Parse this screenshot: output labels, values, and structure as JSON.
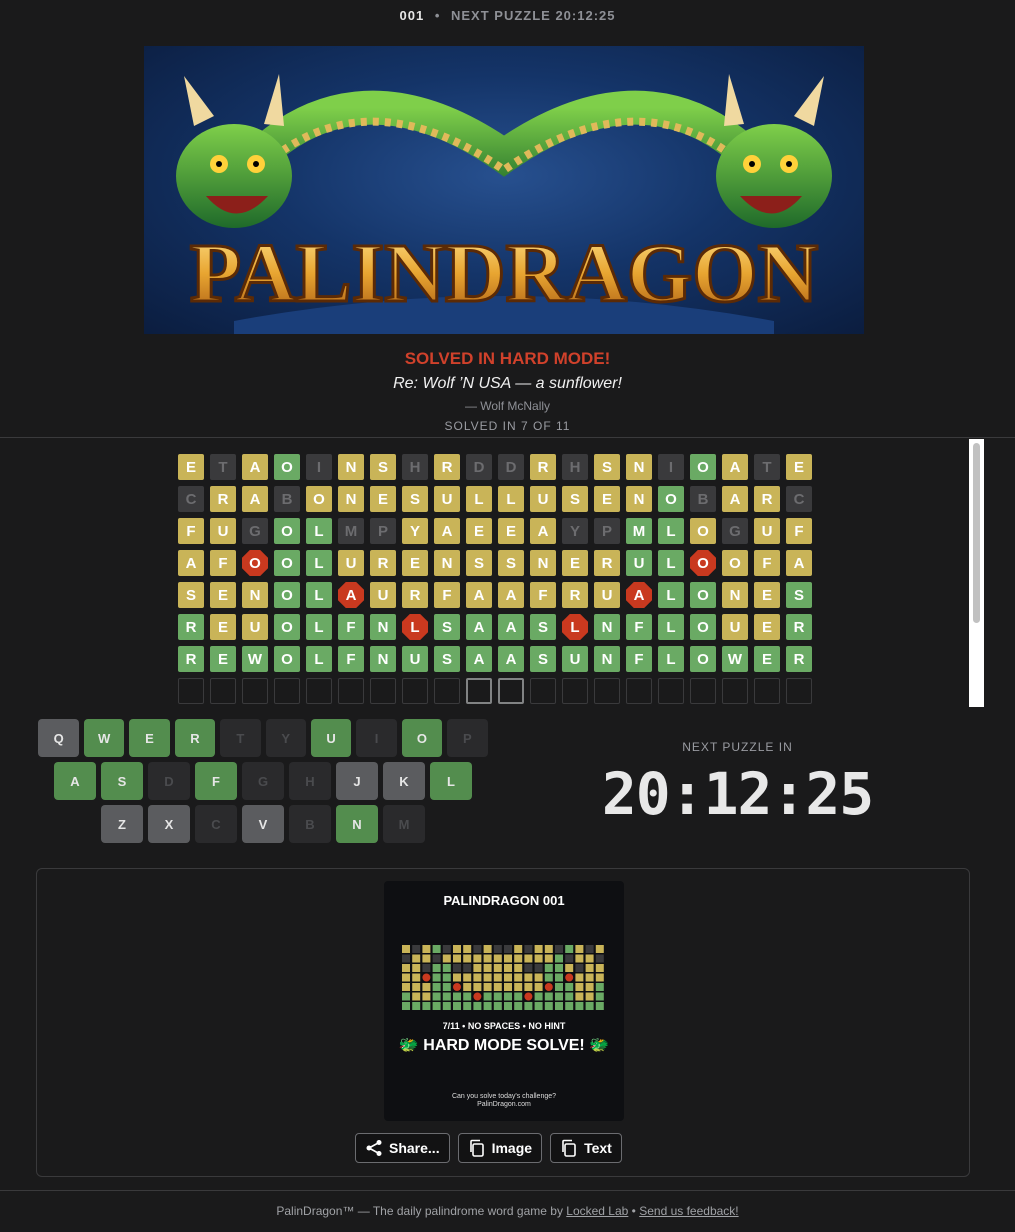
{
  "header": {
    "puzzle_number": "001",
    "separator": "•",
    "next_label": "NEXT PUZZLE 20:12:25"
  },
  "banner": {
    "logo_text": "PALINDRAGON",
    "icon": "dragon-icon"
  },
  "status": {
    "title": "SOLVED IN HARD MODE!",
    "phrase": "Re: Wolf ’N USA — a sunflower!",
    "author": "— Wolf McNally",
    "count": "SOLVED IN 7 OF 11"
  },
  "grid": {
    "rows": [
      {
        "letters": "ETAOINSHRDDRHSNIOATE",
        "states": "ydygdyydyddydyydgydy"
      },
      {
        "letters": "CRABONESULLUSENOBARC",
        "states": "dyydyyyyyyyyyyygdyyd"
      },
      {
        "letters": "FUGOLMPYAEEAYPMLOGUF",
        "states": "yydggddyyyyyddggydyy"
      },
      {
        "letters": "AFOOLURENSSNERULOOFA",
        "states": "yyrggyyyyyyyyyggryyy"
      },
      {
        "letters": "SENOLAURFAAFRUALONES",
        "states": "yyyggryyyyyyyyrggyyg"
      },
      {
        "letters": "REUOLFNLSAASLNFLOUER",
        "states": "gyyggggrggggrggggyyg"
      },
      {
        "letters": "REWOLFNUSAASUNFLOWER",
        "states": "gggggggggggggggggggg"
      }
    ],
    "empty_count": 20
  },
  "keyboard": {
    "rows": [
      [
        {
          "k": "Q",
          "s": "n"
        },
        {
          "k": "W",
          "s": "g"
        },
        {
          "k": "E",
          "s": "g"
        },
        {
          "k": "R",
          "s": "g"
        },
        {
          "k": "T",
          "s": "d"
        },
        {
          "k": "Y",
          "s": "d"
        },
        {
          "k": "U",
          "s": "g"
        },
        {
          "k": "I",
          "s": "d"
        },
        {
          "k": "O",
          "s": "g"
        },
        {
          "k": "P",
          "s": "d"
        }
      ],
      [
        {
          "k": "A",
          "s": "g"
        },
        {
          "k": "S",
          "s": "g"
        },
        {
          "k": "D",
          "s": "d"
        },
        {
          "k": "F",
          "s": "g"
        },
        {
          "k": "G",
          "s": "d"
        },
        {
          "k": "H",
          "s": "d"
        },
        {
          "k": "J",
          "s": "n"
        },
        {
          "k": "K",
          "s": "n"
        },
        {
          "k": "L",
          "s": "g"
        }
      ],
      [
        {
          "k": "Z",
          "s": "n"
        },
        {
          "k": "X",
          "s": "n"
        },
        {
          "k": "C",
          "s": "d"
        },
        {
          "k": "V",
          "s": "n"
        },
        {
          "k": "B",
          "s": "d"
        },
        {
          "k": "N",
          "s": "g"
        },
        {
          "k": "M",
          "s": "d"
        }
      ]
    ]
  },
  "timer": {
    "label": "NEXT PUZZLE IN",
    "value": "20:12:25"
  },
  "share_card": {
    "title": "PALINDRAGON 001",
    "stats": "7/11 • NO SPACES • NO HINT",
    "headline": "🐲 HARD MODE SOLVE! 🐲",
    "cta_line1": "Can you solve today's challenge?",
    "cta_line2": "PalinDragon.com"
  },
  "buttons": {
    "share": "Share...",
    "image": "Image",
    "text": "Text"
  },
  "footer": {
    "prefix": "PalinDragon™ — The daily palindrome word game by ",
    "lab": "Locked Lab",
    "sep": " • ",
    "feedback": "Send us feedback!"
  },
  "colors": {
    "yellow": "#c9b458",
    "green": "#6aaa64",
    "red": "#c9391f",
    "dark": "#3a3a3c",
    "title_red": "#d0412b"
  }
}
